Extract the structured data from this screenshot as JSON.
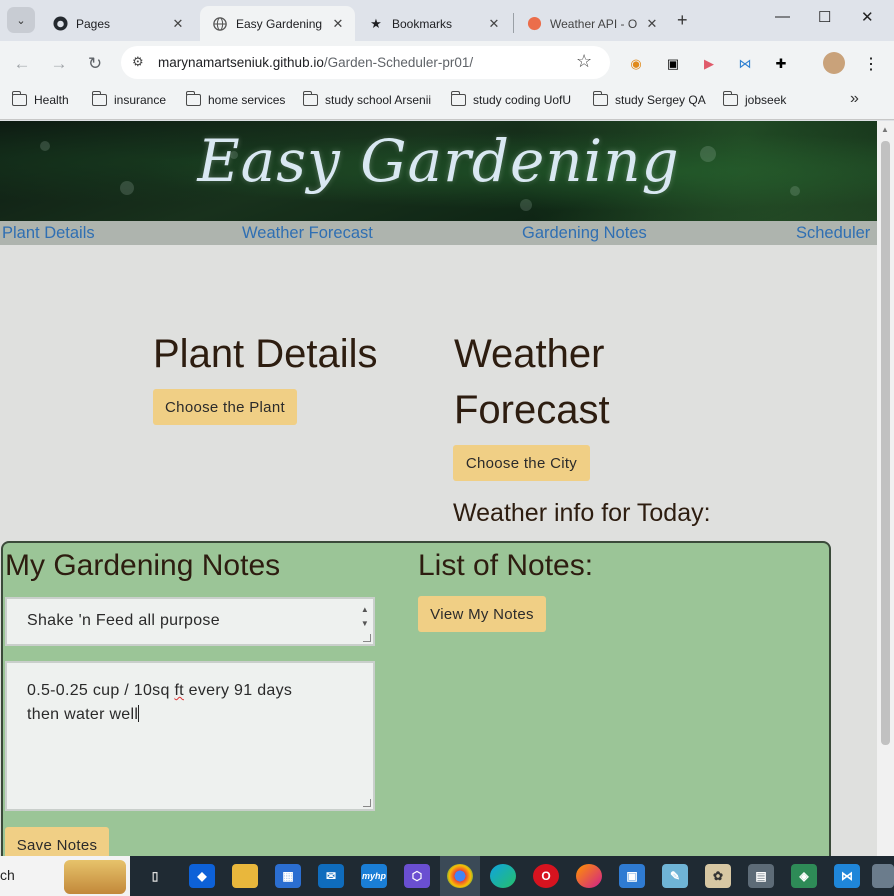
{
  "browser": {
    "tabs": [
      {
        "title": "Pages",
        "icon": "github-icon"
      },
      {
        "title": "Easy Gardening",
        "icon": "globe-icon",
        "active": true
      },
      {
        "title": "Bookmarks",
        "icon": "star-icon"
      },
      {
        "title": "Weather API - O",
        "icon": "openweather-icon"
      }
    ],
    "url_host": "marynamartseniuk.github.io",
    "url_path": "/Garden-Scheduler-pr01/",
    "bookmarks": [
      "Health",
      "insurance",
      "home services",
      "study school Arsenii",
      "study coding UofU",
      "study Sergey QA",
      "jobseek"
    ]
  },
  "site": {
    "banner_title": "Easy Gardening",
    "nav": [
      "Plant Details",
      "Weather Forecast",
      "Gardening Notes",
      "Scheduler"
    ],
    "plant_heading": "Plant Details",
    "plant_button": "Choose the Plant",
    "weather_heading_1": "Weather",
    "weather_heading_2": "Forecast",
    "weather_button": "Choose the City",
    "weather_info": "Weather info for Today:",
    "notes_heading": "My Gardening Notes",
    "product_value": "Shake 'n Feed all purpose",
    "note_line1_a": "0.5-0.25 cup / 10sq ",
    "note_line1_b": "ft",
    "note_line1_c": " every 91 days",
    "note_line2": "then water well",
    "save_button": "Save Notes",
    "list_heading": "List of Notes:",
    "view_button": "View My Notes"
  },
  "taskbar": {
    "search_text": "ch",
    "app_hp": "myhp"
  },
  "colors": {
    "nav_link": "#2f6fb3",
    "gold_button": "#f0cf85",
    "notes_panel": "#9bc597",
    "heading_text": "#2d1d10"
  }
}
